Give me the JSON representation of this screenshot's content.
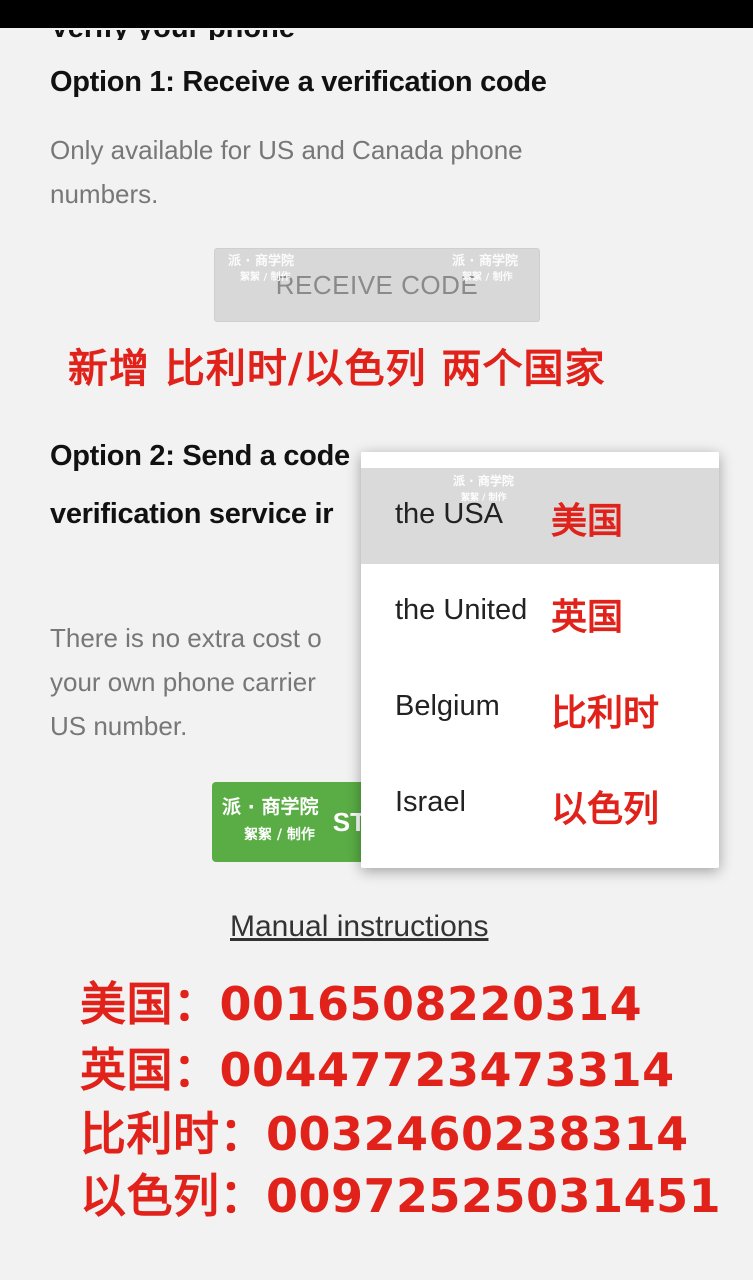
{
  "top_cut_heading": "Verify your phone",
  "option1": {
    "title": "Option 1: Receive a verification code",
    "desc_line1": "Only available for US and Canada phone",
    "desc_line2": "numbers.",
    "button_label": "RECEIVE CODE"
  },
  "banner": "新增 比利时/以色列 两个国家",
  "option2": {
    "title_line1": "Option 2: Send a code",
    "title_line2": "verification service ir",
    "desc_line1": "There is no extra cost o",
    "desc_line2": "your own phone carrier",
    "desc_line3": "US number.",
    "button_label": "ST"
  },
  "watermark": {
    "line1": "派 · 商学院",
    "line2": "絮絮 / 制作"
  },
  "dropdown": {
    "items": [
      {
        "label": "the USA",
        "cn": "美国",
        "selected": true
      },
      {
        "label": "the United",
        "cn": "英国",
        "selected": false
      },
      {
        "label": "Belgium",
        "cn": "比利时",
        "selected": false
      },
      {
        "label": "Israel",
        "cn": "以色列",
        "selected": false
      }
    ]
  },
  "manual_link": "Manual instructions",
  "phones": [
    {
      "country": "美国：",
      "number": "0016508220314"
    },
    {
      "country": "英国：",
      "number": "00447723473314"
    },
    {
      "country": "比利时：",
      "number": "0032460238314"
    },
    {
      "country": "以色列：",
      "number": "00972525031451"
    }
  ],
  "colors": {
    "accent_red": "#e1221a",
    "start_green": "#5aad45",
    "selected_row": "#dadada"
  }
}
